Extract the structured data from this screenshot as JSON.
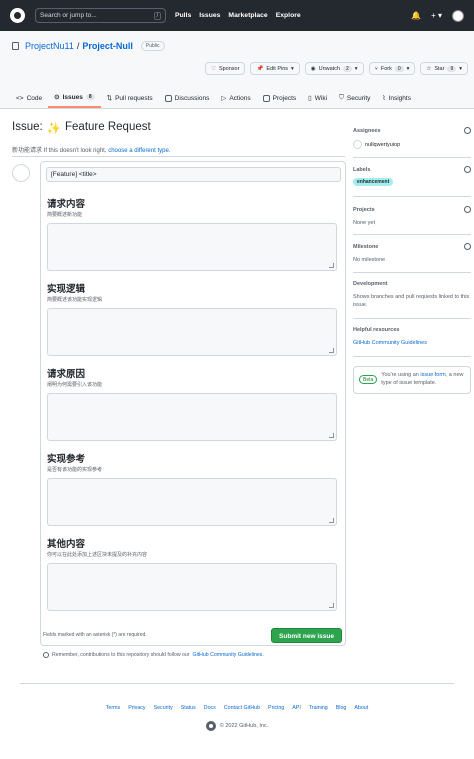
{
  "topbar": {
    "search_placeholder": "Search or jump to...",
    "search_kbd": "/",
    "nav": [
      "Pulls",
      "Issues",
      "Marketplace",
      "Explore"
    ],
    "bell": "🔔",
    "plus": "+ ▾"
  },
  "repo": {
    "owner": "ProjectNu11",
    "sep": "/",
    "name": "Project-Null",
    "visibility": "Public",
    "actions": {
      "sponsor": "Sponsor",
      "edit_pins": "Edit Pins",
      "unwatch": "Unwatch",
      "unwatch_count": "2",
      "fork": "Fork",
      "fork_count": "0",
      "star": "Star",
      "star_count": "9"
    },
    "tabs": [
      {
        "label": "Code"
      },
      {
        "label": "Issues",
        "count": "8"
      },
      {
        "label": "Pull requests"
      },
      {
        "label": "Discussions"
      },
      {
        "label": "Actions"
      },
      {
        "label": "Projects"
      },
      {
        "label": "Wiki"
      },
      {
        "label": "Security"
      },
      {
        "label": "Insights"
      }
    ]
  },
  "issue": {
    "title_prefix": "Issue:",
    "title_emoji": "✨",
    "title_text": "Feature Request",
    "subtitle_lead": "新功能请求 If this doesn't look right,",
    "subtitle_link": "choose a different type.",
    "title_value": "[Feature] <title>",
    "sections": [
      {
        "heading": "请求内容",
        "desc": "简要概述新功能"
      },
      {
        "heading": "实现逻辑",
        "desc": "简要概述该功能实现逻辑"
      },
      {
        "heading": "请求原因",
        "desc": "阐明为何需要引入该功能"
      },
      {
        "heading": "实现参考",
        "desc": "是否有该功能的实现参考"
      },
      {
        "heading": "其他内容",
        "desc": "你可以在此处添加上述区块未提及的补充内容"
      }
    ],
    "required_note": "Fields marked with an asterisk (*) are required.",
    "submit": "Submit new issue",
    "remember_lead": "Remember, contributions to this repository should follow our",
    "remember_link": "GitHub Community Guidelines."
  },
  "sidebar": {
    "assignees_h": "Assignees",
    "assignee": "nullqwertyuiop",
    "labels_h": "Labels",
    "label": "enhancement",
    "label_color": "#a2eeef",
    "projects_h": "Projects",
    "projects_txt": "None yet",
    "milestone_h": "Milestone",
    "milestone_txt": "No milestone",
    "development_h": "Development",
    "development_txt": "Shows branches and pull requests linked to this issue.",
    "resources_h": "Helpful resources",
    "resources_link": "GitHub Community Guidelines",
    "beta": "Beta",
    "beta_lead": "You're using an",
    "beta_link": "issue form",
    "beta_tail": ", a new type of issue template."
  },
  "footer": {
    "links": [
      "Terms",
      "Privacy",
      "Security",
      "Status",
      "Docs",
      "Contact GitHub",
      "Pricing",
      "API",
      "Training",
      "Blog",
      "About"
    ],
    "copyright": "© 2022 GitHub, Inc."
  },
  "colors": {
    "topbar": "#24292f",
    "submit": "#2da44e",
    "link": "#0969da",
    "tab_underline": "#fd8c73"
  }
}
